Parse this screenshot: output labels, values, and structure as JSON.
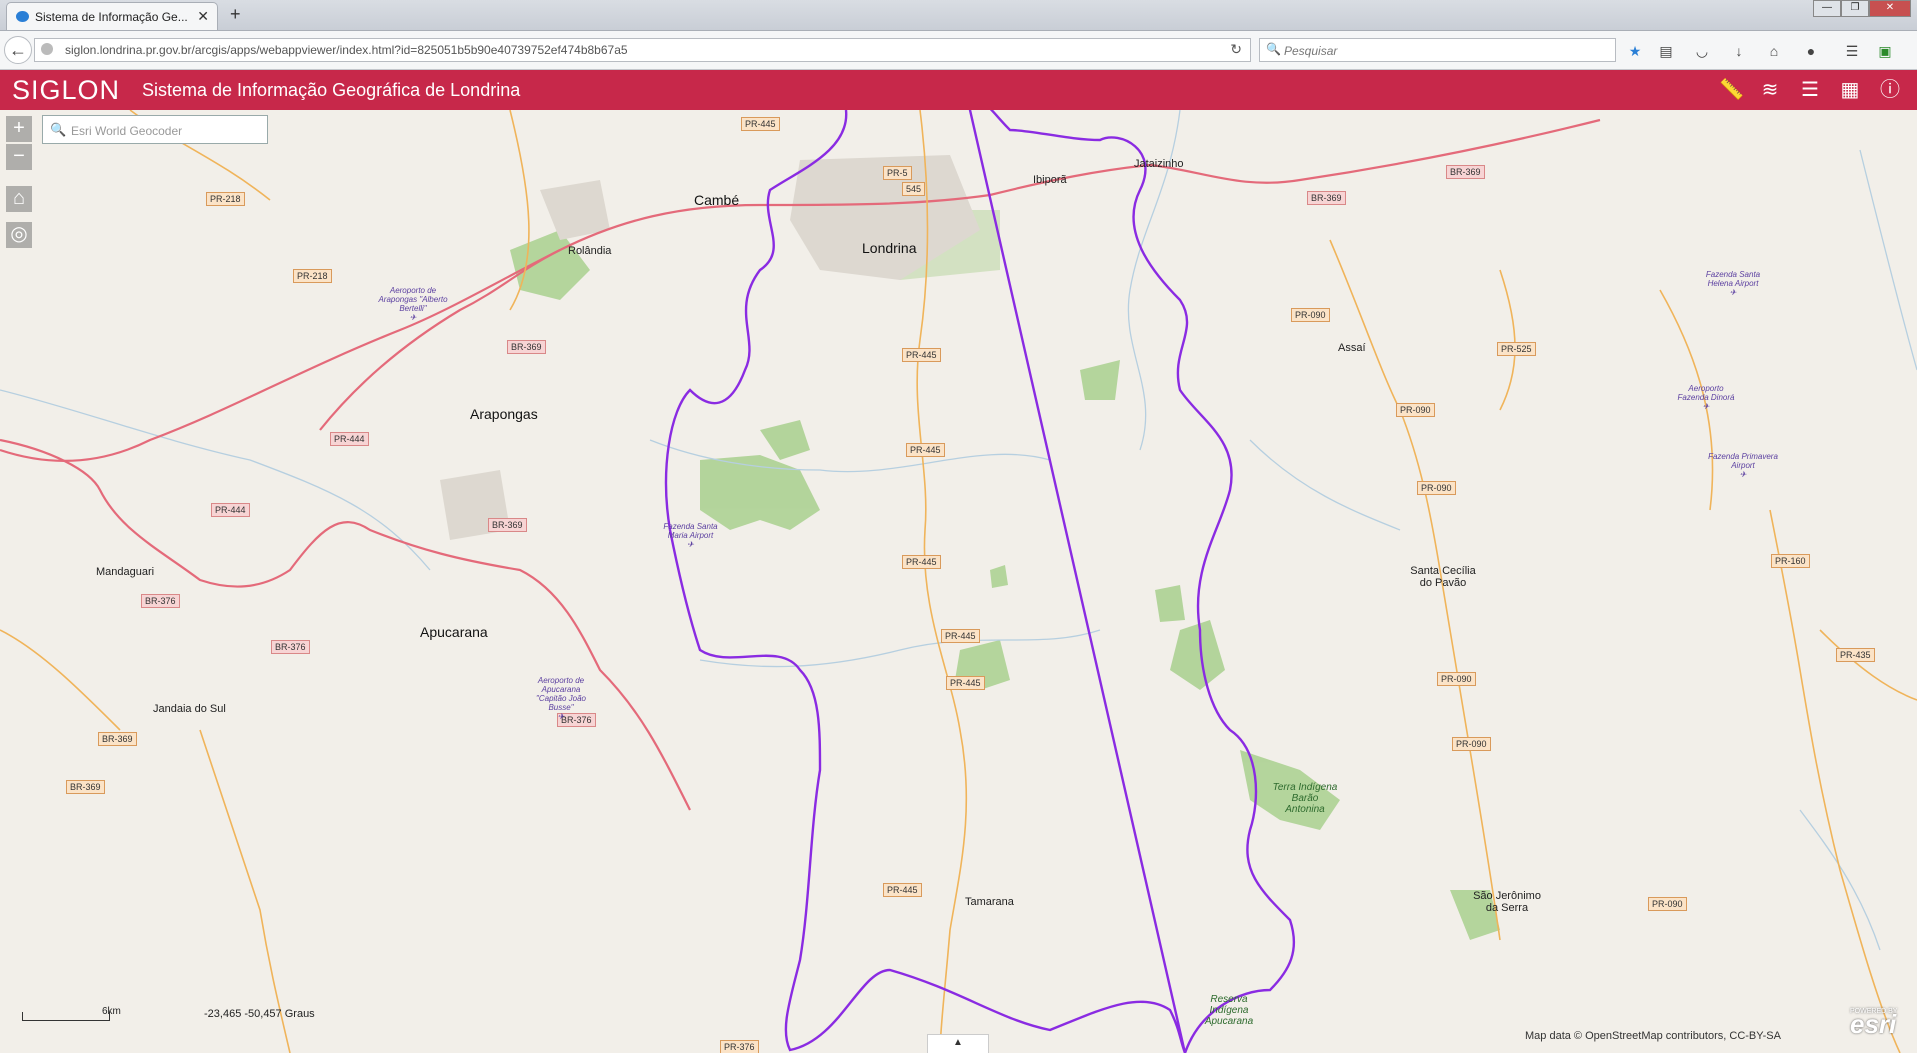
{
  "browser": {
    "tab_title": "Sistema de Informação Ge...",
    "tab_close": "✕",
    "new_tab": "+",
    "window_controls": [
      "—",
      "❐",
      "✕"
    ],
    "url": "siglon.londrina.pr.gov.br/arcgis/apps/webappviewer/index.html?id=825051b5b90e40739752ef474b8b67a5",
    "search_placeholder": "Pesquisar",
    "toolbar_icons": [
      "star-icon",
      "reading-list-icon",
      "pocket-icon",
      "download-icon",
      "home-icon",
      "chat-icon",
      "menu-icon",
      "extension-icon"
    ]
  },
  "app": {
    "logo": "SIGLON",
    "title": "Sistema de Informação Geográfica de Londrina",
    "header_icons": [
      "measure-icon",
      "layers-icon",
      "legend-icon",
      "widgets-icon",
      "info-icon"
    ]
  },
  "map": {
    "zoom_in": "+",
    "zoom_out": "−",
    "geocoder_placeholder": "Esri World Geocoder",
    "scale_label": "6km",
    "coordinates": "-23,465  -50,457 Graus",
    "attribution": "Map data © OpenStreetMap contributors, CC-BY-SA",
    "esri_powered": "POWERED BY",
    "esri_logo": "esri",
    "boundary_color": "#8a2be2",
    "cities": [
      {
        "name": "Cambé"
      },
      {
        "name": "Londrina"
      },
      {
        "name": "Ibiporã"
      },
      {
        "name": "Jataizinho"
      },
      {
        "name": "Rolândia"
      },
      {
        "name": "Arapongas"
      },
      {
        "name": "Assaí"
      },
      {
        "name": "Mandaguari"
      },
      {
        "name": "Apucarana"
      },
      {
        "name": "Jandaia do Sul"
      },
      {
        "name": "Santa Cecília do Pavão"
      },
      {
        "name": "Tamarana"
      },
      {
        "name": "São Jerônimo da Serra"
      }
    ],
    "roads": [
      "PR-445",
      "PR-5",
      "545",
      "BR-369",
      "PR-218",
      "PR-218",
      "BR-369",
      "PR-444",
      "PR-444",
      "BR-369",
      "BR-376",
      "BR-376",
      "BR-376",
      "BR-369",
      "BR-369",
      "PR-445",
      "PR-445",
      "PR-445",
      "PR-445",
      "PR-445",
      "PR-445",
      "PR-090",
      "PR-525",
      "PR-090",
      "PR-090",
      "PR-160",
      "PR-090",
      "PR-090",
      "PR-435",
      "PR-090",
      "BR-369",
      "PR-376"
    ],
    "airports": [
      "Aeroporto de Arapongas \"Alberto Bertelli\"",
      "Fazenda Santa Maria Airport",
      "Aeroporto de Apucarana \"Capitão João Busse\"",
      "Fazenda Santa Helena Airport",
      "Aeroporto Fazenda Dinorá",
      "Fazenda Primavera Airport"
    ],
    "reserves": [
      "Terra Indígena Barão Antonina",
      "Reserva Indígena Apucarana"
    ]
  }
}
